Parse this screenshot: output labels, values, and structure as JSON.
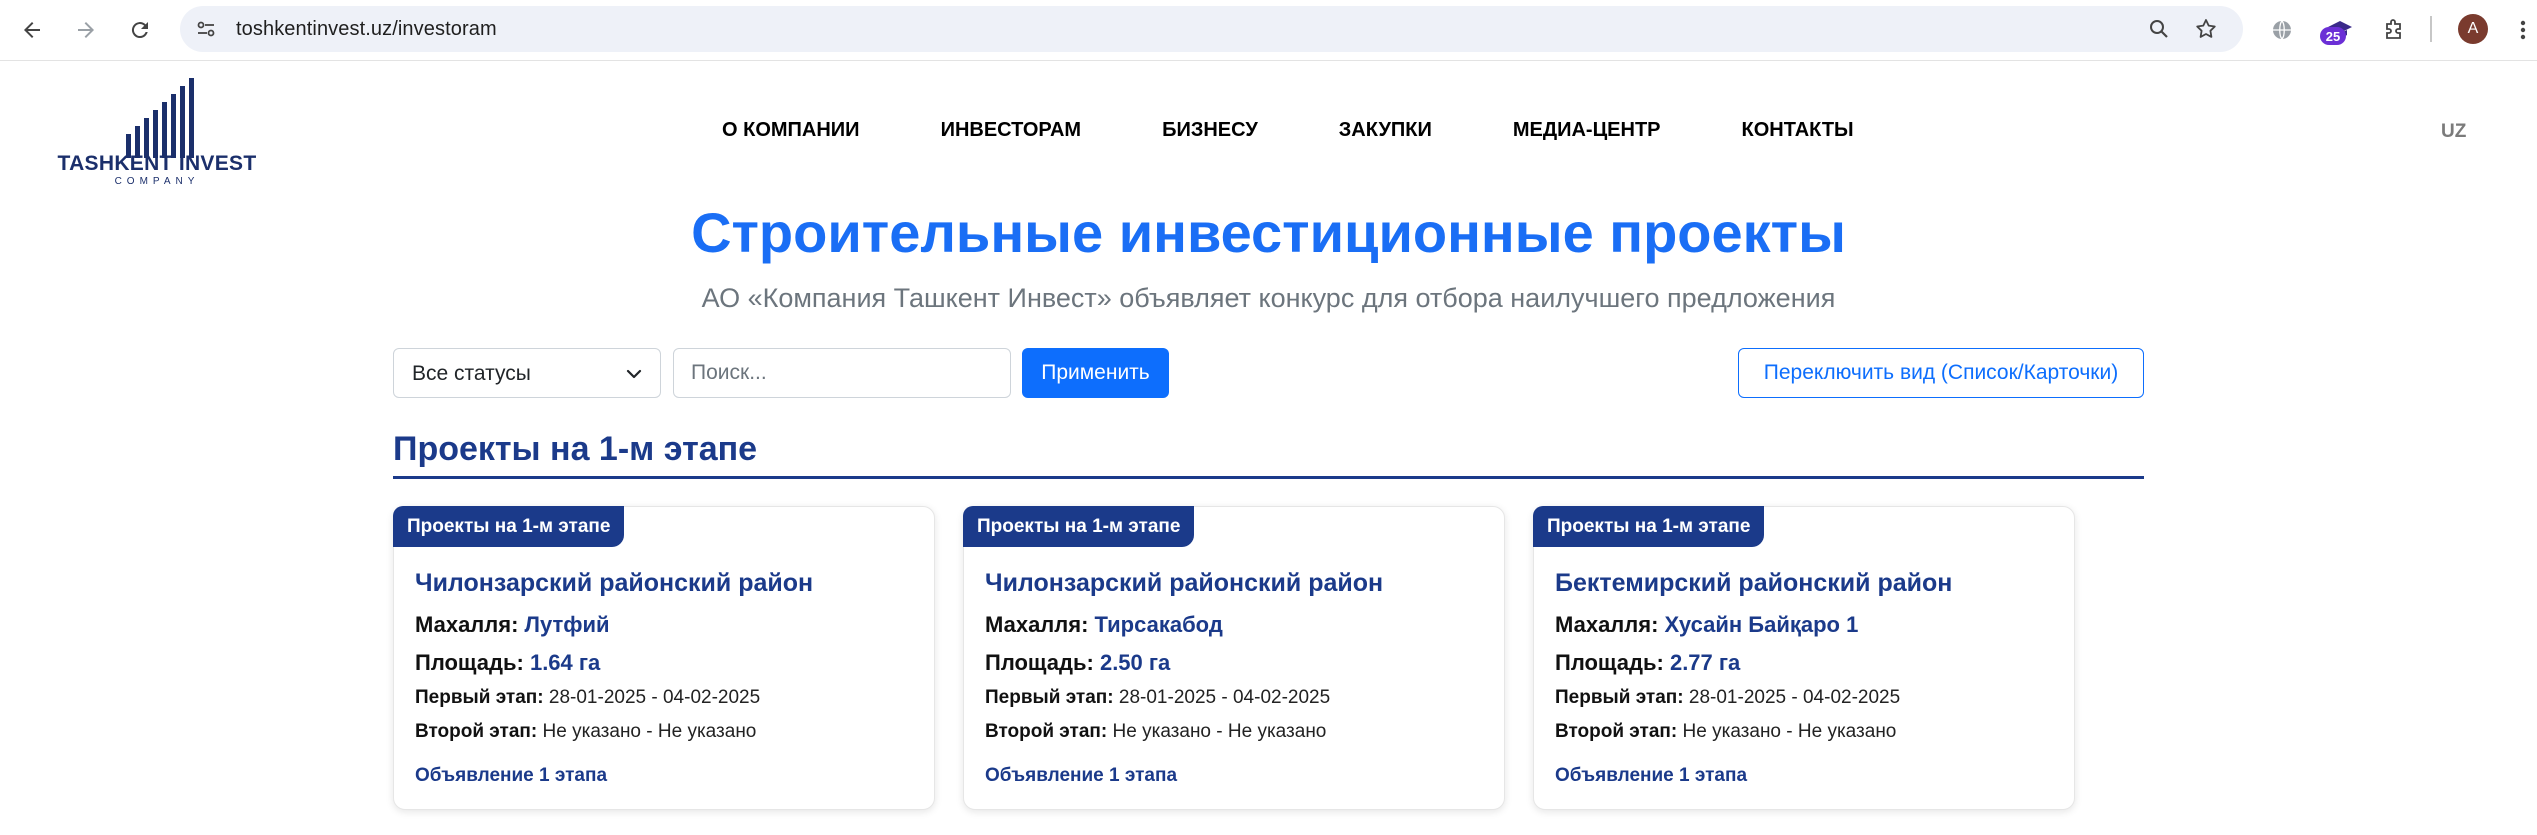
{
  "browser": {
    "url": "toshkentinvest.uz/investoram",
    "extension_badge": "25",
    "profile_initial": "A"
  },
  "header": {
    "logo_name": "TASHKENT INVEST",
    "logo_sub": "COMPANY",
    "menu": [
      {
        "label": "О КОМПАНИИ"
      },
      {
        "label": "ИНВЕСТОРАМ"
      },
      {
        "label": "БИЗНЕСУ"
      },
      {
        "label": "ЗАКУПКИ"
      },
      {
        "label": "МЕДИА-ЦЕНТР"
      },
      {
        "label": "КОНТАКТЫ"
      }
    ],
    "lang": "UZ"
  },
  "hero": {
    "title": "Строительные инвестиционные проекты",
    "subtitle": "АО «Компания Ташкент Инвест» объявляет конкурс для отбора наилучшего предложения"
  },
  "filters": {
    "status_value": "Все статусы",
    "search_placeholder": "Поиск...",
    "apply_label": "Применить",
    "toggle_label": "Переключить вид (Список/Карточки)"
  },
  "section": {
    "title": "Проекты на 1-м этапе"
  },
  "cards": [
    {
      "tag": "Проекты на 1-м этапе",
      "district": "Чилонзарский районский район",
      "mahalla_label": "Махалля:",
      "mahalla": "Лутфий",
      "area_label": "Площадь:",
      "area": "1.64 га",
      "stage1_label": "Первый этап:",
      "stage1": "28-01-2025 - 04-02-2025",
      "stage2_label": "Второй этап:",
      "stage2": "Не указано - Не указано",
      "link": "Объявление 1 этапа"
    },
    {
      "tag": "Проекты на 1-м этапе",
      "district": "Чилонзарский районский район",
      "mahalla_label": "Махалля:",
      "mahalla": "Тирсакабод",
      "area_label": "Площадь:",
      "area": "2.50 га",
      "stage1_label": "Первый этап:",
      "stage1": "28-01-2025 - 04-02-2025",
      "stage2_label": "Второй этап:",
      "stage2": "Не указано - Не указано",
      "link": "Объявление 1 этапа"
    },
    {
      "tag": "Проекты на 1-м этапе",
      "district": "Бектемирский районский район",
      "mahalla_label": "Махалля:",
      "mahalla": "Хусайн Байқаро 1",
      "area_label": "Площадь:",
      "area": "2.77 га",
      "stage1_label": "Первый этап:",
      "stage1": "28-01-2025 - 04-02-2025",
      "stage2_label": "Второй этап:",
      "stage2": "Не указано - Не указано",
      "link": "Объявление 1 этапа"
    }
  ]
}
